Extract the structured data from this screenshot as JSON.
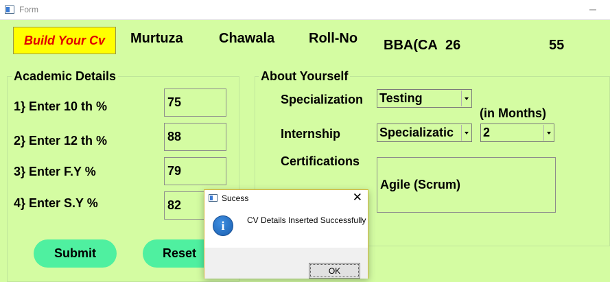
{
  "window": {
    "title": "Form"
  },
  "header": {
    "badge": "Build Your Cv",
    "first_name": "Murtuza",
    "last_name": "Chawala",
    "roll_label": "Roll-No",
    "course": "BBA(CA",
    "course_no": "26",
    "roll_value": "55"
  },
  "academic": {
    "title": "Academic Details",
    "fields": [
      {
        "label": "1} Enter 10 th %",
        "value": "75"
      },
      {
        "label": "2} Enter 12 th %",
        "value": "88"
      },
      {
        "label": "3} Enter F.Y %",
        "value": "79"
      },
      {
        "label": "4} Enter S.Y %",
        "value": "82"
      }
    ]
  },
  "about": {
    "title": "About Yourself",
    "specialization_label": "Specialization",
    "specialization_value": "Testing",
    "months_label": "(in Months)",
    "internship_label": "Internship",
    "internship_value": "Specializatic",
    "internship_months": "2",
    "certifications_label": "Certifications",
    "certifications_value": "Agile (Scrum)"
  },
  "buttons": {
    "submit": "Submit",
    "reset": "Reset"
  },
  "dialog": {
    "title": "Sucess",
    "close": "✕",
    "icon": "info-icon",
    "message": "CV Details Inserted Successfully",
    "ok": "OK"
  },
  "colors": {
    "background": "#d4fca2",
    "badge_bg": "#ffff00",
    "badge_text": "#e00000",
    "pill_button": "#4ff0a0"
  }
}
